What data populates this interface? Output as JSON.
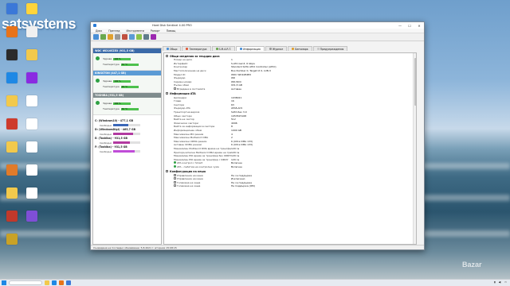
{
  "watermark": "satsystems",
  "brand_mark": "Bazar",
  "desktop_icons": [
    {
      "label": "",
      "color": "#3b78d8"
    },
    {
      "label": "",
      "color": "#e8731a"
    },
    {
      "label": "",
      "color": "#2b2b2b"
    },
    {
      "label": "",
      "color": "#1e88e5"
    },
    {
      "label": "",
      "color": "#f2c94c"
    },
    {
      "label": "",
      "color": "#ce3b2c"
    },
    {
      "label": "",
      "color": "#f2c94c"
    },
    {
      "label": "",
      "color": "#e07b2a"
    },
    {
      "label": "",
      "color": "#f2c94c"
    },
    {
      "label": "",
      "color": "#c0392b"
    },
    {
      "label": "",
      "color": "#c9a227"
    },
    {
      "label": "",
      "color": "#ffd43b"
    },
    {
      "label": "",
      "color": "#f0f0f0"
    },
    {
      "label": "",
      "color": "#f2c94c"
    },
    {
      "label": "",
      "color": "#8a2be2"
    },
    {
      "label": "",
      "color": "#ffffff"
    },
    {
      "label": "",
      "color": "#ffffff"
    },
    {
      "label": "",
      "color": "#ffffff"
    },
    {
      "label": "",
      "color": "#ffffff"
    },
    {
      "label": "",
      "color": "#ffffff"
    },
    {
      "label": "",
      "color": "#7f4fd6"
    }
  ],
  "window": {
    "title": "Hard Disk Sentinel 4.00 PRO",
    "menu": [
      "Диск",
      "Преглед",
      "Инструменти",
      "Рапорт",
      "Помощ"
    ],
    "tabs": [
      {
        "label": "Общо",
        "color": "#4a8fd6"
      },
      {
        "label": "Температура",
        "color": "#e05b3a"
      },
      {
        "label": "S.M.A.R.T.",
        "color": "#6aa84f"
      },
      {
        "label": "Информация",
        "color": "#4a8fd6",
        "active": true
      },
      {
        "label": "Журнал",
        "color": "#999999"
      },
      {
        "label": "Бенчмарк",
        "color": "#e0a030"
      },
      {
        "label": "Предупреждения",
        "color": "#c9c9c9"
      }
    ],
    "status_text": "Създадена на последно обновяване: 5.8.2021 г. вторник 15:08:15"
  },
  "disks": [
    {
      "name": "WDC WD10EZEX (931,5 GB)",
      "head_color": "#3b6aa8",
      "health_label": "Здраве",
      "health": "100 %",
      "temp_label": "Температура",
      "temp": "32 °C"
    },
    {
      "name": "KINGSTON (447,1 GB)",
      "head_color": "#5b9bd5",
      "health_label": "Здраве",
      "health": "100 %",
      "temp_label": "Температура",
      "temp": "29 °C"
    },
    {
      "name": "TOSHIBA (931,5 GB)",
      "head_color": "#7f8c8d",
      "health_label": "Здраве",
      "health": "100 %",
      "temp_label": "Температура",
      "temp": "30 °C"
    }
  ],
  "volumes": [
    {
      "title": "C: (Windows10) - 477,1 GB",
      "free_label": "Свободно",
      "free": "",
      "fill": 0.55,
      "color": "#3a67b8"
    },
    {
      "title": "D: (WindowsDigi) - 465,7 GB",
      "free_label": "Свободно",
      "free": "",
      "fill": 0.72,
      "color": "#b23aa0"
    },
    {
      "title": "E: (Toshiba) - 931,5 GB",
      "free_label": "Свободно",
      "free": "",
      "fill": 0.6,
      "color": "#b23aa0"
    },
    {
      "title": "F: (Toshiba) - 931,5 GB",
      "free_label": "Свободно",
      "free": "",
      "fill": 0.8,
      "color": "#c04cd8"
    }
  ],
  "sections": [
    {
      "title": "Общи сведения за твърдия диск",
      "rows": [
        {
          "k": "Номер на диск",
          "v": "1"
        },
        {
          "k": "Интерфейс",
          "v": "S-ATA Gen3, 6 Gbps"
        },
        {
          "k": "Контролер",
          "v": "Standard SATA AHCI Controller (AHCI)"
        },
        {
          "k": "Местоположение на диск",
          "v": "Bus Number 0, Target Id 0, LUN 0"
        },
        {
          "k": "Модел ID",
          "v": "WDC WD10EZEX"
        },
        {
          "k": "Фърмуер",
          "v": "WD"
        },
        {
          "k": "Сериен номер",
          "v": "WD-WCC"
        },
        {
          "k": "Пълен обем",
          "v": "931,5 GB"
        },
        {
          "k": "Вградена в системата",
          "v": "Активен",
          "icon": "box"
        }
      ]
    },
    {
      "title": "Информация ATA",
      "rows": [
        {
          "k": "Цилиндри",
          "v": "1938021"
        },
        {
          "k": "Глави",
          "v": "16"
        },
        {
          "k": "Сектори",
          "v": "63"
        },
        {
          "k": "Фърмуер ATA",
          "v": "ATA8-ACS"
        },
        {
          "k": "Транспортна версия",
          "v": "SATA Rev 3.0"
        },
        {
          "k": "Общо сектори",
          "v": "1953525168"
        },
        {
          "k": "Байта на сектор",
          "v": "512"
        },
        {
          "k": "Физически сектори",
          "v": "4096"
        },
        {
          "k": "Байта за информация в сектора",
          "v": "8"
        },
        {
          "k": "Информационен обем",
          "v": "1000 GB"
        },
        {
          "k": "Максимален PIO режим",
          "v": "4"
        },
        {
          "k": "Максимален Multiword DMA",
          "v": "2"
        },
        {
          "k": "Максимален UDMA режим",
          "v": "6 (Ultra DMA 133)"
        },
        {
          "k": "Активен UDMA режим",
          "v": "6 (Ultra DMA 133)"
        },
        {
          "k": "Минимален Multiword DMA време на трансфер",
          "v": "120 ns"
        },
        {
          "k": "Препоръчителна Multiword DMA време на трансфер",
          "v": "120 ns"
        },
        {
          "k": "Минимален PIO време за трансфер без IORDY",
          "v": "120 ns"
        },
        {
          "k": "Минимален PIO време за трансфер с IORDY",
          "v": "120 ns"
        },
        {
          "k": "ATA контрол с Smart",
          "v": "Включен",
          "icon": "dot"
        },
        {
          "k": "ATA - събитие на контролни сума",
          "v": "Включен",
          "icon": "dot"
        }
      ]
    },
    {
      "title": "Конфигурация на кеша",
      "rows": [
        {
          "k": "Управление на кеша",
          "v": "Не се поддържа",
          "icon": "box"
        },
        {
          "k": "Управление на кеша",
          "v": "Изключено",
          "icon": "box"
        },
        {
          "k": "Големина на кеша",
          "v": "Не се поддържа",
          "icon": "box"
        },
        {
          "k": "Големина на кеша",
          "v": "Не поддържа (ОМ)",
          "icon": "box"
        }
      ]
    }
  ]
}
